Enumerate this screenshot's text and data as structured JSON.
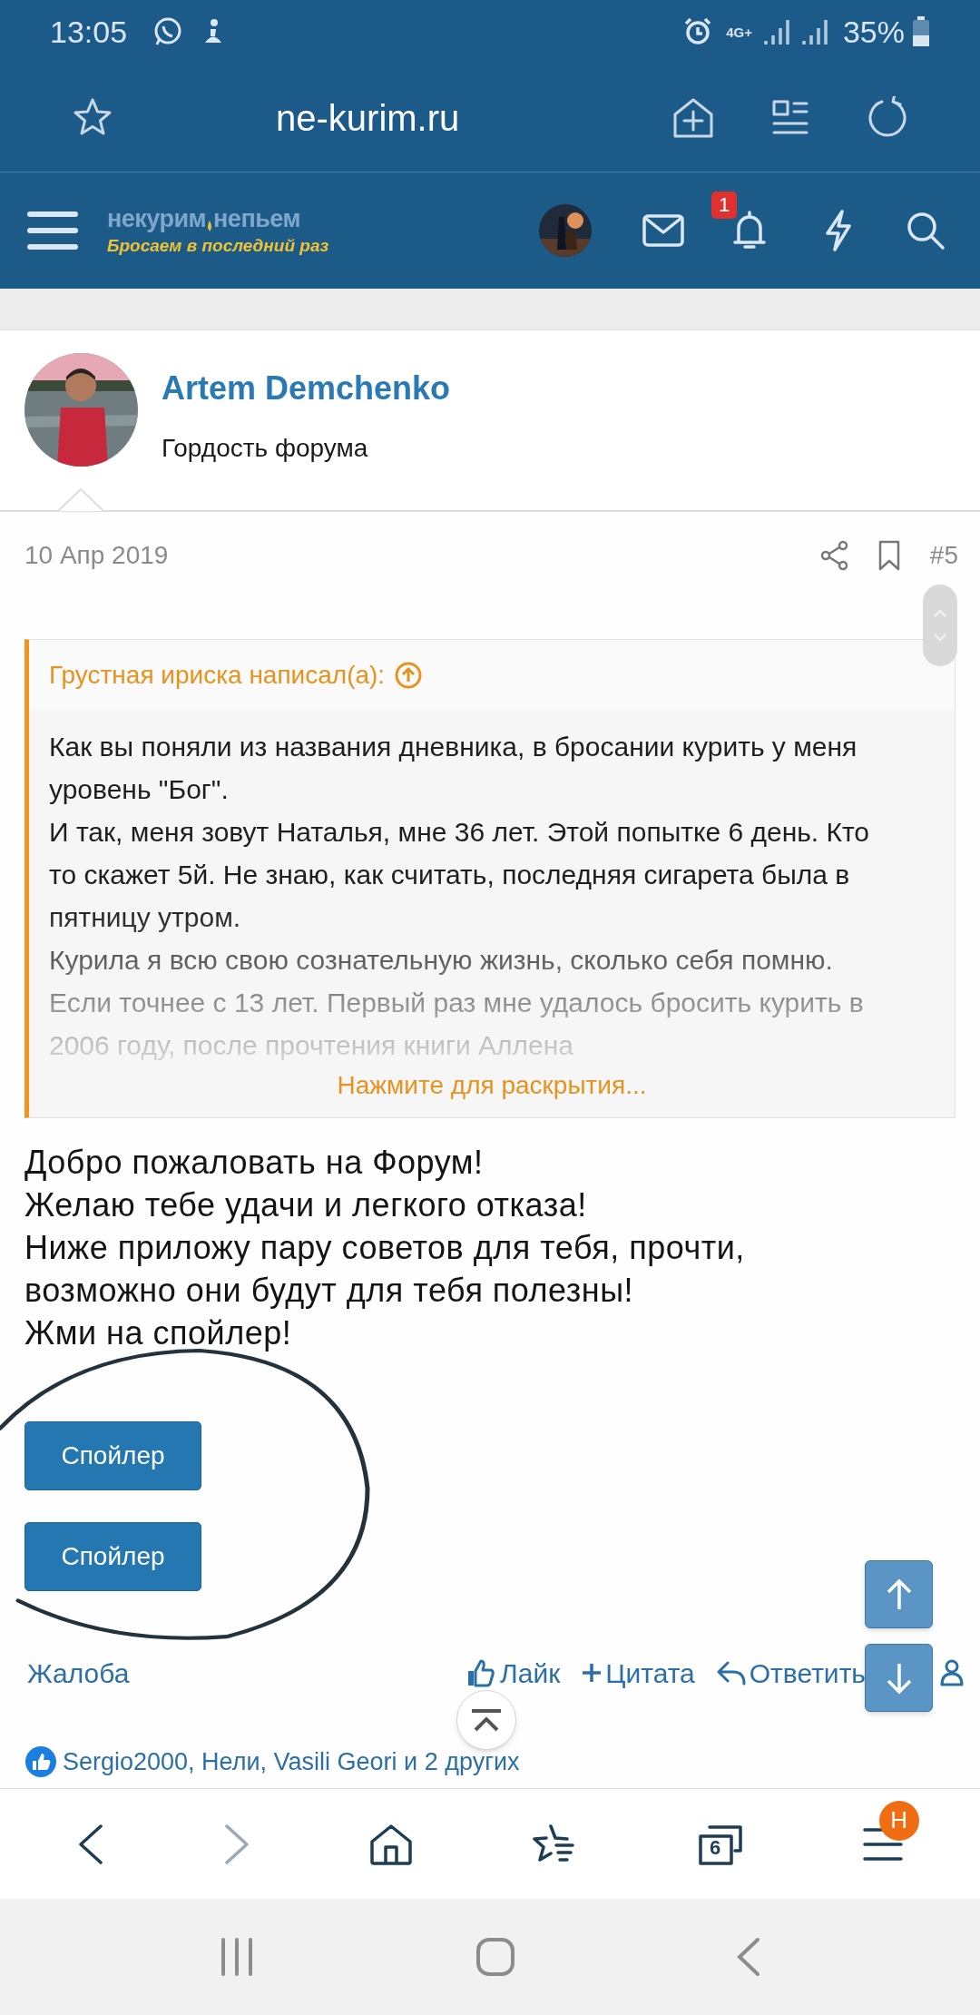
{
  "status_bar": {
    "time": "13:05",
    "network": "4G+",
    "battery": "35%"
  },
  "browser_bar": {
    "url": "ne-kurim.ru"
  },
  "site_header": {
    "logo_left": "некурим",
    "logo_right": "непьем",
    "logo_tagline": "Бросаем в последний раз",
    "notifications_badge": "1"
  },
  "post": {
    "author": "Artem Demchenko",
    "author_title": "Гордость форума",
    "date": "10 Апр 2019",
    "number": "#5",
    "quote": {
      "header": "Грустная ириска написал(а):",
      "paragraphs": [
        "Как вы поняли из названия дневника, в бросании курить у меня уровень \"Бог\".",
        "И так, меня зовут Наталья, мне 36 лет. Этой попытке 6 день. Кто то скажет 5й. Не знаю, как считать, последняя сигарета была в пятницу утром.",
        "Курила я всю свою сознательную жизнь, сколько себя помню. Если точнее с 13 лет. Первый раз мне удалось бросить курить в 2006 году, после прочтения книги Аллена"
      ],
      "expand_label": "Нажмите для раскрытия..."
    },
    "body": [
      "Добро пожаловать на Форум!",
      "Желаю тебе удачи и легкого отказа!",
      "Ниже приложу пару советов для тебя, прочти, возможно они будут для тебя полезны!",
      "Жми на спойлер!"
    ],
    "spoilers": [
      "Спойлер",
      "Спойлер"
    ],
    "actions": [
      {
        "kind": "report",
        "label": "Жалоба"
      },
      {
        "kind": "like",
        "label": "Лайк"
      },
      {
        "kind": "quote",
        "label": "Цитата"
      },
      {
        "kind": "reply",
        "label": "Ответить"
      }
    ],
    "likes": "Sergio2000, Нели, Vasili Geori и 2 других"
  },
  "bottom_bar": {
    "forward_disabled": true,
    "tabs_count": "6",
    "profile_badge": "Н"
  }
}
